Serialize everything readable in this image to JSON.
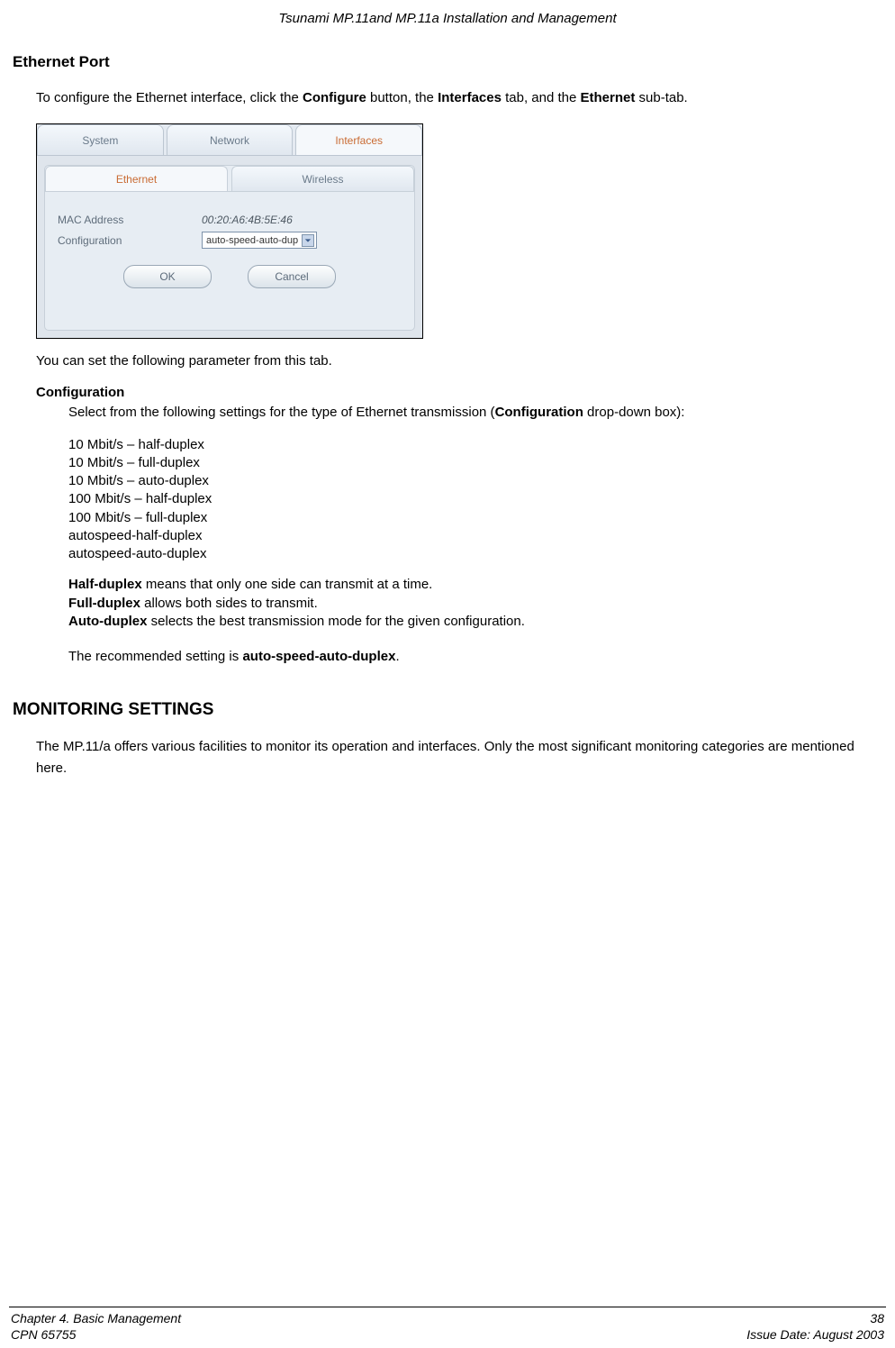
{
  "running_head": "Tsunami MP.11and MP.11a Installation and Management",
  "section1_title": "Ethernet Port",
  "intro": {
    "p1a": "To configure the Ethernet interface, click the ",
    "b1": "Configure",
    "p1b": " button, the ",
    "b2": "Interfaces",
    "p1c": " tab, and the ",
    "b3": "Ethernet",
    "p1d": " sub-tab."
  },
  "ui": {
    "top_tabs": {
      "t1": "System",
      "t2": "Network",
      "t3": "Interfaces"
    },
    "sub_tabs": {
      "t1": "Ethernet",
      "t2": "Wireless"
    },
    "mac_label": "MAC Address",
    "mac_value": "00:20:A6:4B:5E:46",
    "config_label": "Configuration",
    "config_value": "auto-speed-auto-dup",
    "ok": "OK",
    "cancel": "Cancel"
  },
  "after_shot": "You can set the following parameter from this tab.",
  "config_head": "Configuration",
  "config_body": {
    "a": "Select from the following settings for the type of Ethernet transmission (",
    "b": "Configuration",
    "c": " drop-down box):"
  },
  "duplex_options": {
    "o1": "10 Mbit/s – half-duplex",
    "o2": "10 Mbit/s – full-duplex",
    "o3": "10 Mbit/s – auto-duplex",
    "o4": "100 Mbit/s – half-duplex",
    "o5": "100 Mbit/s – full-duplex",
    "o6": "autospeed-half-duplex",
    "o7": "autospeed-auto-duplex"
  },
  "defs": {
    "hd_b": "Half-duplex",
    "hd_t": " means that only one side can transmit at a time.",
    "fd_b": "Full-duplex",
    "fd_t": " allows both sides to transmit.",
    "ad_b": "Auto-duplex",
    "ad_t": " selects the best transmission mode for the given configuration."
  },
  "reco": {
    "a": "The recommended setting is ",
    "b": "auto-speed-auto-duplex",
    "c": "."
  },
  "section2_title": "MONITORING SETTINGS",
  "mon_body": "The MP.11/a offers various facilities to monitor its operation and interfaces.  Only the most significant monitoring categories are mentioned here.",
  "footer": {
    "chapter": "Chapter 4.  Basic Management",
    "cpn": "CPN 65755",
    "page": "38",
    "issue": "Issue Date:  August 2003"
  }
}
